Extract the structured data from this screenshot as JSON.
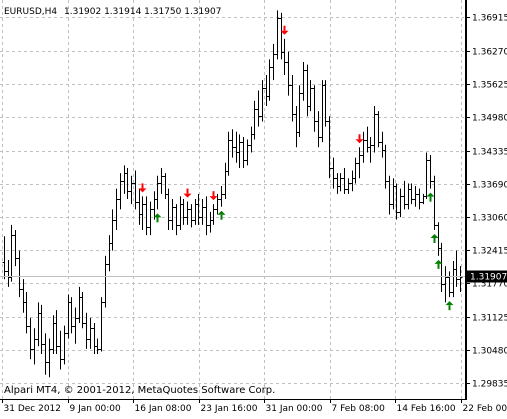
{
  "header": {
    "symbol_timeframe": "EURUSD,H4",
    "ohlc": "1.31902 1.31914 1.31750 1.31907"
  },
  "footer": {
    "copyright": "Alpari MT4, © 2001-2012, MetaQuotes Software Corp."
  },
  "colors": {
    "background": "#ffffff",
    "bars": "#000000",
    "grid": "#c0c0c0",
    "up_arrow": "#008000",
    "down_arrow": "#ff0000",
    "current_price_box": "#000000",
    "current_price_text": "#ffffff"
  },
  "chart_data": {
    "type": "bar",
    "symbol": "EURUSD",
    "timeframe": "H4",
    "current_price": 1.31907,
    "ylim": [
      1.2953,
      1.3725
    ],
    "y_ticks": [
      1.36915,
      1.3627,
      1.35625,
      1.3498,
      1.34335,
      1.3369,
      1.3306,
      1.32415,
      1.3177,
      1.31125,
      1.3048,
      1.29835
    ],
    "y_tick_labels": [
      "1.36915",
      "1.36270",
      "1.35625",
      "1.34980",
      "1.34335",
      "1.33690",
      "1.33060",
      "1.32415",
      "1.31770",
      "1.31125",
      "1.30480",
      "1.29835"
    ],
    "x_tick_labels": [
      "31 Dec 2012",
      "9 Jan 00:00",
      "16 Jan 08:00",
      "23 Jan 16:00",
      "31 Jan 00:00",
      "7 Feb 08:00",
      "14 Feb 16:00",
      "22 Feb 00:00"
    ],
    "grid": true,
    "bars": [
      [
        1.3218,
        1.3268,
        1.3185,
        1.32
      ],
      [
        1.32,
        1.3222,
        1.317,
        1.319
      ],
      [
        1.319,
        1.329,
        1.318,
        1.327
      ],
      [
        1.327,
        1.328,
        1.321,
        1.3225
      ],
      [
        1.3225,
        1.324,
        1.315,
        1.3165
      ],
      [
        1.3165,
        1.3185,
        1.312,
        1.314
      ],
      [
        1.314,
        1.316,
        1.308,
        1.3095
      ],
      [
        1.3095,
        1.311,
        1.303,
        1.305
      ],
      [
        1.305,
        1.309,
        1.302,
        1.307
      ],
      [
        1.307,
        1.314,
        1.3055,
        1.312
      ],
      [
        1.312,
        1.3135,
        1.304,
        1.306
      ],
      [
        1.306,
        1.308,
        1.3,
        1.3025
      ],
      [
        1.3025,
        1.307,
        1.2995,
        1.305
      ],
      [
        1.305,
        1.3115,
        1.304,
        1.31
      ],
      [
        1.31,
        1.3125,
        1.304,
        1.3055
      ],
      [
        1.3055,
        1.3085,
        1.301,
        1.303
      ],
      [
        1.303,
        1.3095,
        1.302,
        1.308
      ],
      [
        1.308,
        1.3155,
        1.307,
        1.314
      ],
      [
        1.314,
        1.315,
        1.308,
        1.3095
      ],
      [
        1.3095,
        1.313,
        1.306,
        1.311
      ],
      [
        1.311,
        1.317,
        1.31,
        1.315
      ],
      [
        1.315,
        1.316,
        1.309,
        1.31
      ],
      [
        1.31,
        1.312,
        1.305,
        1.307
      ],
      [
        1.307,
        1.311,
        1.305,
        1.309
      ],
      [
        1.309,
        1.31,
        1.304,
        1.3055
      ],
      [
        1.3055,
        1.307,
        1.304,
        1.305
      ],
      [
        1.305,
        1.315,
        1.3045,
        1.314
      ],
      [
        1.314,
        1.323,
        1.313,
        1.3215
      ],
      [
        1.3215,
        1.327,
        1.32,
        1.3255
      ],
      [
        1.3255,
        1.332,
        1.324,
        1.33
      ],
      [
        1.33,
        1.336,
        1.328,
        1.334
      ],
      [
        1.334,
        1.339,
        1.332,
        1.3375
      ],
      [
        1.3375,
        1.3405,
        1.335,
        1.339
      ],
      [
        1.339,
        1.34,
        1.334,
        1.3355
      ],
      [
        1.3355,
        1.3385,
        1.333,
        1.337
      ],
      [
        1.337,
        1.3395,
        1.332,
        1.3335
      ],
      [
        1.3335,
        1.336,
        1.329,
        1.331
      ],
      [
        1.331,
        1.3345,
        1.328,
        1.333
      ],
      [
        1.333,
        1.3345,
        1.327,
        1.3285
      ],
      [
        1.3285,
        1.3335,
        1.327,
        1.332
      ],
      [
        1.332,
        1.3355,
        1.33,
        1.334
      ],
      [
        1.334,
        1.3385,
        1.332,
        1.337
      ],
      [
        1.337,
        1.34,
        1.335,
        1.3385
      ],
      [
        1.3385,
        1.339,
        1.334,
        1.335
      ],
      [
        1.335,
        1.336,
        1.328,
        1.33
      ],
      [
        1.33,
        1.334,
        1.328,
        1.3325
      ],
      [
        1.3325,
        1.333,
        1.327,
        1.329
      ],
      [
        1.329,
        1.3345,
        1.328,
        1.333
      ],
      [
        1.333,
        1.334,
        1.329,
        1.3305
      ],
      [
        1.3305,
        1.3335,
        1.329,
        1.332
      ],
      [
        1.332,
        1.333,
        1.3285,
        1.33
      ],
      [
        1.33,
        1.334,
        1.329,
        1.333
      ],
      [
        1.333,
        1.335,
        1.329,
        1.3305
      ],
      [
        1.3305,
        1.334,
        1.329,
        1.3325
      ],
      [
        1.3325,
        1.3345,
        1.327,
        1.329
      ],
      [
        1.329,
        1.3315,
        1.3275,
        1.33
      ],
      [
        1.33,
        1.333,
        1.329,
        1.332
      ],
      [
        1.332,
        1.335,
        1.331,
        1.334
      ],
      [
        1.334,
        1.3365,
        1.3325,
        1.335
      ],
      [
        1.335,
        1.341,
        1.334,
        1.3395
      ],
      [
        1.3395,
        1.347,
        1.3385,
        1.3455
      ],
      [
        1.3455,
        1.3475,
        1.342,
        1.344
      ],
      [
        1.344,
        1.347,
        1.341,
        1.343
      ],
      [
        1.343,
        1.3465,
        1.34,
        1.345
      ],
      [
        1.345,
        1.346,
        1.34,
        1.3415
      ],
      [
        1.3415,
        1.3455,
        1.3405,
        1.3445
      ],
      [
        1.3445,
        1.348,
        1.343,
        1.3465
      ],
      [
        1.3465,
        1.353,
        1.3455,
        1.3515
      ],
      [
        1.3515,
        1.355,
        1.348,
        1.35
      ],
      [
        1.35,
        1.357,
        1.349,
        1.3555
      ],
      [
        1.3555,
        1.358,
        1.352,
        1.354
      ],
      [
        1.354,
        1.361,
        1.353,
        1.3595
      ],
      [
        1.3595,
        1.364,
        1.357,
        1.362
      ],
      [
        1.362,
        1.3705,
        1.361,
        1.369
      ],
      [
        1.369,
        1.37,
        1.361,
        1.3625
      ],
      [
        1.3625,
        1.365,
        1.358,
        1.3605
      ],
      [
        1.3605,
        1.3625,
        1.354,
        1.356
      ],
      [
        1.356,
        1.358,
        1.349,
        1.3505
      ],
      [
        1.3505,
        1.352,
        1.344,
        1.347
      ],
      [
        1.347,
        1.356,
        1.346,
        1.3545
      ],
      [
        1.3545,
        1.3605,
        1.353,
        1.359
      ],
      [
        1.359,
        1.36,
        1.35,
        1.352
      ],
      [
        1.352,
        1.357,
        1.351,
        1.3555
      ],
      [
        1.3555,
        1.356,
        1.347,
        1.349
      ],
      [
        1.349,
        1.351,
        1.344,
        1.346
      ],
      [
        1.346,
        1.357,
        1.345,
        1.356
      ],
      [
        1.356,
        1.357,
        1.348,
        1.349
      ],
      [
        1.349,
        1.35,
        1.338,
        1.34
      ],
      [
        1.34,
        1.342,
        1.336,
        1.338
      ],
      [
        1.338,
        1.339,
        1.335,
        1.3365
      ],
      [
        1.3365,
        1.339,
        1.3355,
        1.338
      ],
      [
        1.338,
        1.34,
        1.335,
        1.336
      ],
      [
        1.336,
        1.338,
        1.335,
        1.337
      ],
      [
        1.337,
        1.3395,
        1.3355,
        1.338
      ],
      [
        1.338,
        1.342,
        1.337,
        1.341
      ],
      [
        1.341,
        1.344,
        1.338,
        1.3425
      ],
      [
        1.3425,
        1.347,
        1.341,
        1.3455
      ],
      [
        1.3455,
        1.348,
        1.343,
        1.344
      ],
      [
        1.344,
        1.346,
        1.341,
        1.3445
      ],
      [
        1.3445,
        1.352,
        1.343,
        1.3505
      ],
      [
        1.3505,
        1.351,
        1.344,
        1.345
      ],
      [
        1.345,
        1.347,
        1.342,
        1.3435
      ],
      [
        1.3435,
        1.3445,
        1.336,
        1.3375
      ],
      [
        1.3375,
        1.3385,
        1.331,
        1.333
      ],
      [
        1.333,
        1.338,
        1.332,
        1.3365
      ],
      [
        1.3365,
        1.337,
        1.33,
        1.3315
      ],
      [
        1.3315,
        1.336,
        1.3305,
        1.3345
      ],
      [
        1.3345,
        1.3375,
        1.332,
        1.333
      ],
      [
        1.333,
        1.337,
        1.332,
        1.336
      ],
      [
        1.336,
        1.337,
        1.333,
        1.334
      ],
      [
        1.334,
        1.3365,
        1.3325,
        1.335
      ],
      [
        1.335,
        1.336,
        1.332,
        1.3335
      ],
      [
        1.3335,
        1.335,
        1.333,
        1.3345
      ],
      [
        1.3345,
        1.343,
        1.334,
        1.3415
      ],
      [
        1.3415,
        1.3425,
        1.336,
        1.3375
      ],
      [
        1.3375,
        1.3385,
        1.328,
        1.329
      ],
      [
        1.329,
        1.3295,
        1.323,
        1.3245
      ],
      [
        1.3245,
        1.3255,
        1.316,
        1.3175
      ],
      [
        1.3175,
        1.321,
        1.314,
        1.319
      ],
      [
        1.319,
        1.32,
        1.315,
        1.316
      ],
      [
        1.316,
        1.322,
        1.315,
        1.3205
      ],
      [
        1.3205,
        1.324,
        1.317,
        1.3185
      ],
      [
        1.3185,
        1.321,
        1.316,
        1.319
      ]
    ],
    "markers": [
      {
        "type": "down",
        "bar": 37
      },
      {
        "type": "up",
        "bar": 41
      },
      {
        "type": "down",
        "bar": 49
      },
      {
        "type": "down",
        "bar": 56
      },
      {
        "type": "up",
        "bar": 58
      },
      {
        "type": "down",
        "bar": 75
      },
      {
        "type": "down",
        "bar": 95
      },
      {
        "type": "up",
        "bar": 114
      },
      {
        "type": "up",
        "bar": 115
      },
      {
        "type": "up",
        "bar": 116
      },
      {
        "type": "up",
        "bar": 119
      }
    ]
  }
}
